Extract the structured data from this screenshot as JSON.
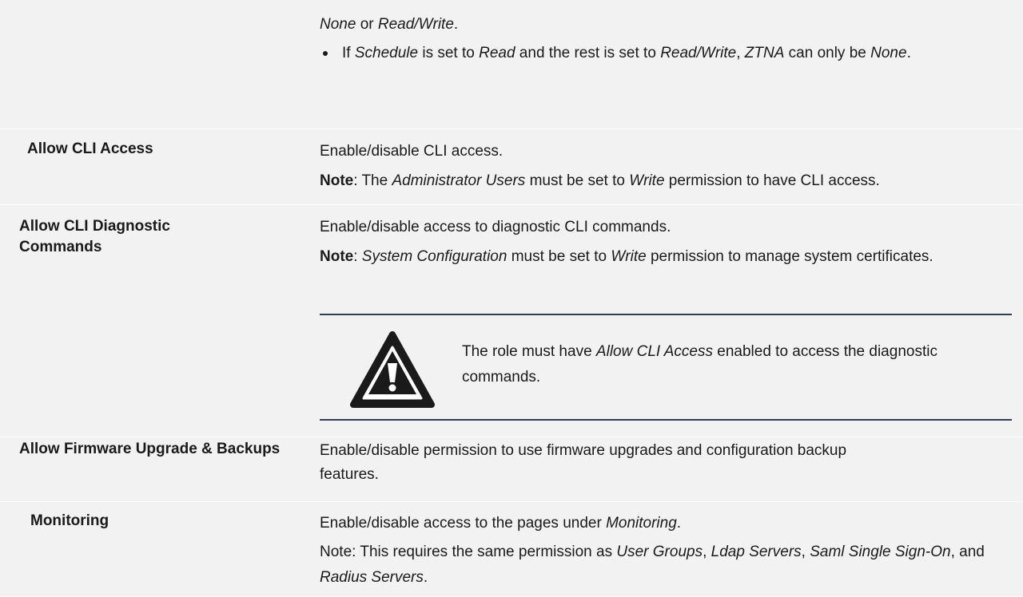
{
  "rows": [
    {
      "label": "",
      "cont_line": [
        "None",
        " or ",
        "Read/Write",
        "."
      ],
      "bullet": [
        "If ",
        "Schedule",
        " is set to ",
        "Read",
        " and the rest is set to ",
        "Read/Write",
        ", ",
        "ZTNA",
        " can only be ",
        "None",
        "."
      ]
    },
    {
      "label": "Allow CLI Access",
      "desc": "Enable/disable CLI access.",
      "note": [
        "Note",
        ": The ",
        "Administrator Users",
        " must be set to ",
        "Write",
        " permission to have CLI access."
      ]
    },
    {
      "label": "Allow CLI Diagnostic Commands",
      "desc": "Enable/disable access to diagnostic CLI commands.",
      "note": [
        "Note",
        ": ",
        "System Configuration",
        " must be set to ",
        "Write",
        " permission to manage system certificates."
      ],
      "warning": [
        "The role must have ",
        "Allow CLI Access",
        " enabled to access the diagnostic commands."
      ]
    },
    {
      "label": "Allow Firmware Upgrade & Backups",
      "desc": "Enable/disable permission to use firmware upgrades and configuration backup features."
    },
    {
      "label": "Monitoring",
      "desc": [
        "Enable/disable access to the pages under ",
        "Monitoring",
        "."
      ],
      "note": [
        "Note: This requires the same permission as ",
        "User Groups",
        ", ",
        "Ldap Servers",
        ", ",
        "Saml Single Sign-On",
        ", and ",
        "Radius Servers",
        "."
      ]
    }
  ]
}
